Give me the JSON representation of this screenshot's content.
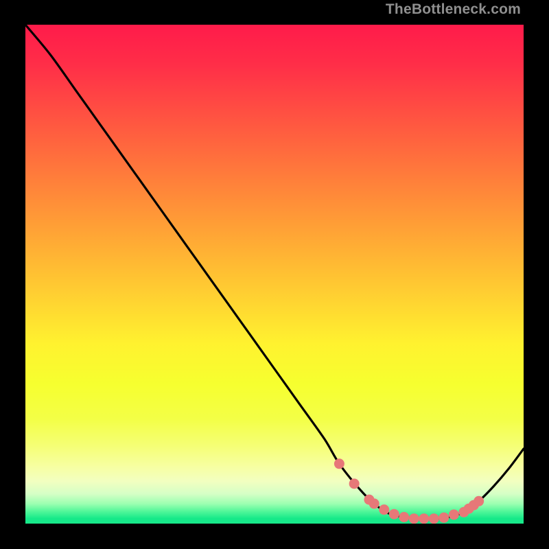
{
  "attribution": "TheBottleneck.com",
  "colors": {
    "bg": "#000000",
    "curve": "#000000",
    "marker_fill": "#e77878",
    "marker_stroke": "#d25a5a"
  },
  "chart_data": {
    "type": "line",
    "title": "",
    "xlabel": "",
    "ylabel": "",
    "xlim": [
      0,
      100
    ],
    "ylim": [
      0,
      100
    ],
    "x": [
      0,
      5,
      10,
      15,
      20,
      25,
      30,
      35,
      40,
      45,
      50,
      55,
      60,
      63,
      67,
      70,
      73,
      76,
      79,
      82,
      85,
      88,
      91,
      94,
      97,
      100
    ],
    "y": [
      100,
      94,
      87,
      80,
      73,
      66,
      59,
      52,
      45,
      38,
      31,
      24,
      17,
      12,
      7,
      4,
      2,
      1.3,
      1.0,
      1.0,
      1.3,
      2.3,
      4.5,
      7.5,
      11,
      15
    ],
    "markers": {
      "x": [
        63,
        66,
        69,
        70,
        72,
        74,
        76,
        78,
        80,
        82,
        84,
        86,
        88,
        89,
        90,
        91
      ],
      "y": [
        12,
        8,
        4.8,
        4,
        2.8,
        1.9,
        1.3,
        1.0,
        1.0,
        1.0,
        1.2,
        1.8,
        2.3,
        3.0,
        3.7,
        4.5
      ]
    },
    "gradient_stops": [
      {
        "offset": 0.0,
        "color": "#ff1b4a"
      },
      {
        "offset": 0.08,
        "color": "#ff2e48"
      },
      {
        "offset": 0.16,
        "color": "#ff4a43"
      },
      {
        "offset": 0.24,
        "color": "#ff663e"
      },
      {
        "offset": 0.32,
        "color": "#ff823a"
      },
      {
        "offset": 0.4,
        "color": "#ff9e36"
      },
      {
        "offset": 0.48,
        "color": "#ffba33"
      },
      {
        "offset": 0.56,
        "color": "#ffd631"
      },
      {
        "offset": 0.64,
        "color": "#fff22f"
      },
      {
        "offset": 0.72,
        "color": "#f6ff2f"
      },
      {
        "offset": 0.79,
        "color": "#f3ff46"
      },
      {
        "offset": 0.845,
        "color": "#f5ff76"
      },
      {
        "offset": 0.885,
        "color": "#f7ffa1"
      },
      {
        "offset": 0.915,
        "color": "#f2ffc0"
      },
      {
        "offset": 0.94,
        "color": "#d6ffc6"
      },
      {
        "offset": 0.96,
        "color": "#9dffb1"
      },
      {
        "offset": 0.975,
        "color": "#54f79a"
      },
      {
        "offset": 0.99,
        "color": "#16e989"
      },
      {
        "offset": 1.0,
        "color": "#18e98a"
      }
    ]
  }
}
